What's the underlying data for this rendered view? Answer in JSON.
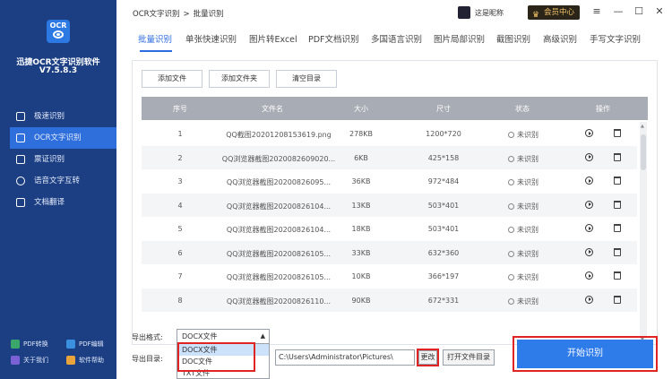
{
  "app": {
    "logo_text": "OCR",
    "name": "迅捷OCR文字识别软件",
    "version": "V7.5.8.3"
  },
  "sidebar": {
    "items": [
      {
        "label": "极速识别",
        "icon": "lightning-icon"
      },
      {
        "label": "OCR文字识别",
        "icon": "ocr-scan-icon",
        "active": true
      },
      {
        "label": "票证识别",
        "icon": "ticket-icon"
      },
      {
        "label": "语音文字互转",
        "icon": "microphone-icon"
      },
      {
        "label": "文档翻译",
        "icon": "translate-icon"
      }
    ],
    "bottom_links": [
      {
        "label": "PDF转换",
        "color": "#3aa66a"
      },
      {
        "label": "PDF编辑",
        "color": "#3b8fe0"
      },
      {
        "label": "关于我们",
        "color": "#7a62d6"
      },
      {
        "label": "软件帮助",
        "color": "#e8a33a"
      }
    ]
  },
  "topbar": {
    "breadcrumb_root": "OCR文字识别",
    "breadcrumb_sep": ">",
    "breadcrumb_current": "批量识别",
    "username": "这是昵称",
    "vip_label": "会员中心",
    "minimize": "—",
    "maximize": "☐",
    "close": "✕"
  },
  "tabs": [
    "批量识别",
    "单张快速识别",
    "图片转Excel",
    "PDF文档识别",
    "多国语言识别",
    "图片局部识别",
    "截图识别",
    "高级识别",
    "手写文字识别"
  ],
  "toolbar": {
    "add_file": "添加文件",
    "add_folder": "添加文件夹",
    "clear_list": "清空目录"
  },
  "table": {
    "headers": [
      "序号",
      "文件名",
      "大小",
      "尺寸",
      "状态",
      "操作"
    ],
    "status_text": "未识别",
    "rows": [
      {
        "no": "1",
        "name": "QQ截图20201208153619.png",
        "size": "278KB",
        "dim": "1200*720"
      },
      {
        "no": "2",
        "name": "QQ浏览器截图2020082609020...",
        "size": "6KB",
        "dim": "425*158"
      },
      {
        "no": "3",
        "name": "QQ浏览器截图20200826095...",
        "size": "36KB",
        "dim": "972*484"
      },
      {
        "no": "4",
        "name": "QQ浏览器截图20200826104...",
        "size": "13KB",
        "dim": "503*401"
      },
      {
        "no": "5",
        "name": "QQ浏览器截图20200826104...",
        "size": "18KB",
        "dim": "503*401"
      },
      {
        "no": "6",
        "name": "QQ浏览器截图20200826105...",
        "size": "33KB",
        "dim": "632*360"
      },
      {
        "no": "7",
        "name": "QQ浏览器截图20200826105...",
        "size": "10KB",
        "dim": "366*197"
      },
      {
        "no": "8",
        "name": "QQ浏览器截图20200826110...",
        "size": "90KB",
        "dim": "672*331"
      }
    ]
  },
  "export": {
    "format_label": "导出格式:",
    "format_selected": "DOCX文件",
    "format_options": [
      "DOCX文件",
      "DOC文件",
      "TXT文件"
    ],
    "dir_label": "导出目录:",
    "dir_value": "C:\\Users\\Administrator\\Pictures\\",
    "change_label": "更改",
    "open_folder_label": "打开文件目录"
  },
  "start_button": "开始识别",
  "colors": {
    "sidebar_bg": "#1c3f84",
    "accent": "#2e7bea",
    "highlight_box": "#e02424"
  }
}
